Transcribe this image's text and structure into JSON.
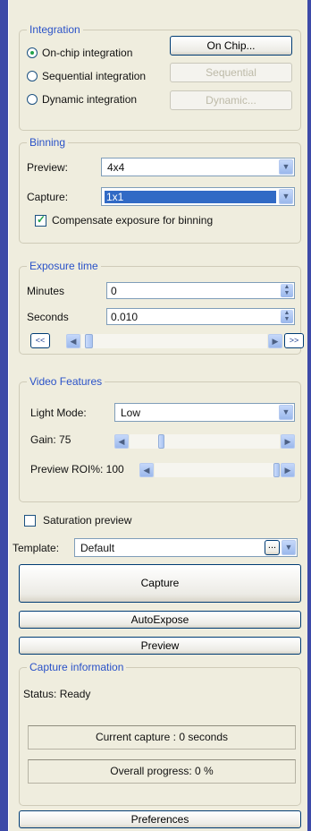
{
  "integration": {
    "legend": "Integration",
    "options": [
      {
        "label": "On-chip integration",
        "selected": true
      },
      {
        "label": "Sequential integration",
        "selected": false
      },
      {
        "label": "Dynamic integration",
        "selected": false
      }
    ],
    "buttons": [
      {
        "label": "On Chip...",
        "enabled": true
      },
      {
        "label": "Sequential",
        "enabled": false
      },
      {
        "label": "Dynamic...",
        "enabled": false
      }
    ]
  },
  "binning": {
    "legend": "Binning",
    "preview_label": "Preview:",
    "preview_value": "4x4",
    "capture_label": "Capture:",
    "capture_value": "1x1",
    "compensate_label": "Compensate exposure for binning",
    "compensate_checked": true
  },
  "exposure": {
    "legend": "Exposure time",
    "minutes_label": "Minutes",
    "minutes_value": "0",
    "seconds_label": "Seconds",
    "seconds_value": "0.010",
    "prev_label": "<<",
    "next_label": ">>",
    "slider_level": 0.02
  },
  "video": {
    "legend": "Video Features",
    "light_mode_label": "Light Mode:",
    "light_mode_value": "Low",
    "gain_label": "Gain: 75",
    "gain_level": 0.2,
    "roi_label": "Preview ROI%: 100",
    "roi_level": 1.0
  },
  "saturation": {
    "label": "Saturation preview",
    "checked": false
  },
  "template": {
    "label": "Template:",
    "value": "Default",
    "browse_label": "..."
  },
  "buttons": {
    "capture": "Capture",
    "autoexpose": "AutoExpose",
    "preview": "Preview",
    "preferences": "Preferences"
  },
  "capture_info": {
    "legend": "Capture information",
    "status": "Status: Ready",
    "current_capture": "Current capture :  0 seconds",
    "overall_progress": "Overall progress: 0 %"
  },
  "colors": {
    "legend": "#2a52c8",
    "panel": "#efedde",
    "frame": "#3d4aa8"
  }
}
